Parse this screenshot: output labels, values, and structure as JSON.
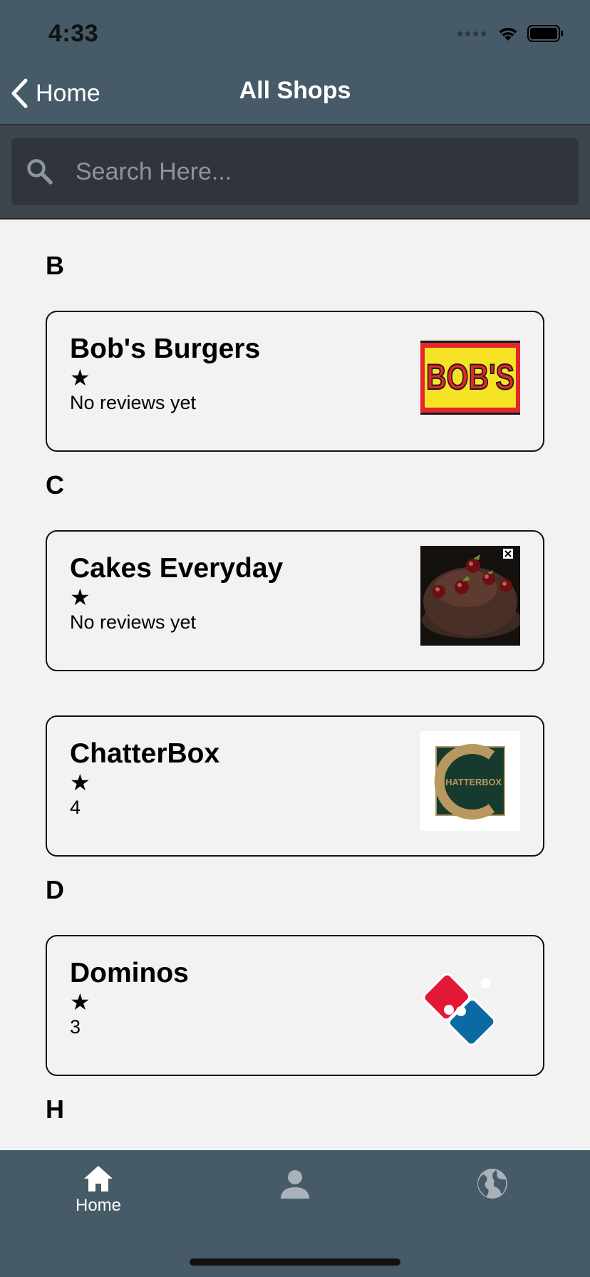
{
  "status_bar": {
    "time": "4:33"
  },
  "header": {
    "back_label": "Home",
    "title": "All Shops"
  },
  "search": {
    "placeholder": "Search Here..."
  },
  "sections": [
    {
      "letter": "B"
    },
    {
      "letter": "C"
    },
    {
      "letter": "D"
    },
    {
      "letter": "H"
    }
  ],
  "shops": [
    {
      "name": "Bob's Burgers",
      "rating": "No reviews yet",
      "logo": "bobs-burgers-logo",
      "logo_text": "BOB'S"
    },
    {
      "name": "Cakes Everyday",
      "rating": "No reviews yet",
      "logo": "chocolate-cake-photo"
    },
    {
      "name": "ChatterBox",
      "rating": "4",
      "logo": "chatterbox-logo",
      "logo_text": "CHATTERBOX"
    },
    {
      "name": "Dominos",
      "rating": "3",
      "logo": "dominos-logo"
    }
  ],
  "tabs": [
    {
      "label": "Home",
      "icon": "home-icon"
    },
    {
      "label": "",
      "icon": "profile-icon"
    },
    {
      "label": "",
      "icon": "globe-icon"
    }
  ],
  "colors": {
    "header_bg": "#465a67",
    "search_band_bg": "#3e454c",
    "page_bg": "#f2f2f2",
    "bobs_red": "#e2262b",
    "bobs_yellow": "#f7e325",
    "chatterbox_green": "#173a2f",
    "chatterbox_gold": "#b99760",
    "dominos_red": "#e31837",
    "dominos_blue": "#0b6aa2"
  }
}
